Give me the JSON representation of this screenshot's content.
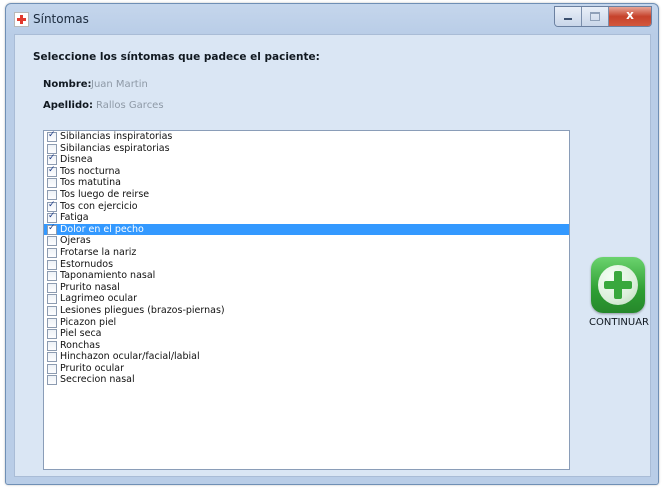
{
  "window": {
    "title": "Síntomas"
  },
  "form": {
    "instruction": "Seleccione los síntomas que padece el paciente:",
    "nombre_label": "Nombre:",
    "nombre_value": "Juan Martin",
    "apellido_label": "Apellido:",
    "apellido_value": "Rallos Garces"
  },
  "symptoms": [
    {
      "label": "Sibilancias inspiratorias",
      "checked": true,
      "selected": false
    },
    {
      "label": "Sibilancias espiratorias",
      "checked": false,
      "selected": false
    },
    {
      "label": "Disnea",
      "checked": true,
      "selected": false
    },
    {
      "label": "Tos nocturna",
      "checked": true,
      "selected": false
    },
    {
      "label": "Tos matutina",
      "checked": false,
      "selected": false
    },
    {
      "label": "Tos luego de reirse",
      "checked": false,
      "selected": false
    },
    {
      "label": "Tos con ejercicio",
      "checked": true,
      "selected": false
    },
    {
      "label": "Fatiga",
      "checked": true,
      "selected": false
    },
    {
      "label": "Dolor en el pecho",
      "checked": true,
      "selected": true
    },
    {
      "label": "Ojeras",
      "checked": false,
      "selected": false
    },
    {
      "label": "Frotarse la nariz",
      "checked": false,
      "selected": false
    },
    {
      "label": "Estornudos",
      "checked": false,
      "selected": false
    },
    {
      "label": "Taponamiento nasal",
      "checked": false,
      "selected": false
    },
    {
      "label": "Prurito nasal",
      "checked": false,
      "selected": false
    },
    {
      "label": "Lagrimeo ocular",
      "checked": false,
      "selected": false
    },
    {
      "label": "Lesiones pliegues (brazos-piernas)",
      "checked": false,
      "selected": false
    },
    {
      "label": "Picazon piel",
      "checked": false,
      "selected": false
    },
    {
      "label": "Piel seca",
      "checked": false,
      "selected": false
    },
    {
      "label": "Ronchas",
      "checked": false,
      "selected": false
    },
    {
      "label": "Hinchazon ocular/facial/labial",
      "checked": false,
      "selected": false
    },
    {
      "label": "Prurito ocular",
      "checked": false,
      "selected": false
    },
    {
      "label": "Secrecion nasal",
      "checked": false,
      "selected": false
    }
  ],
  "continue_button": {
    "label": "CONTINUAR",
    "icon": "plus-icon",
    "color": "#2e9e33"
  },
  "colors": {
    "selection": "#3399ff",
    "client_bg": "#dae6f4"
  }
}
